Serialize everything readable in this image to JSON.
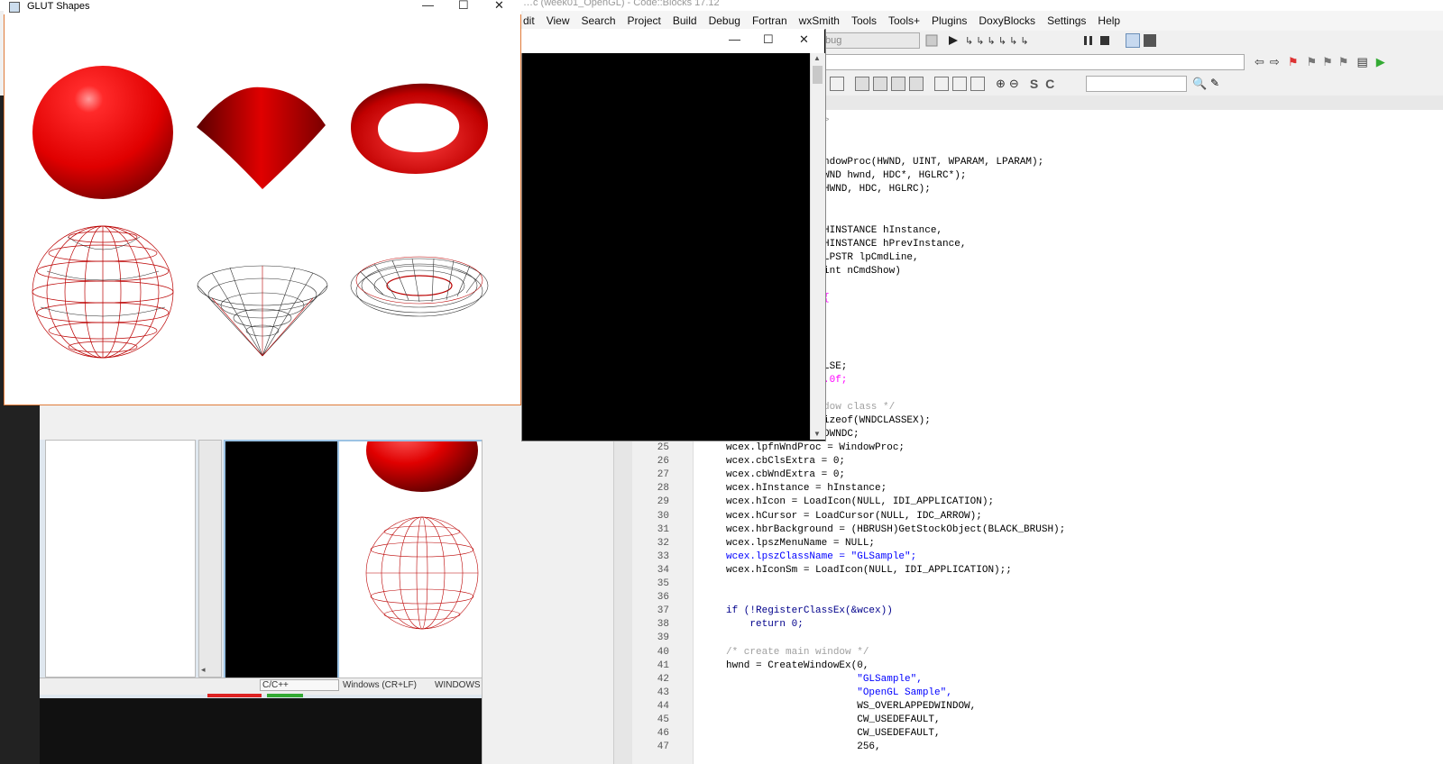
{
  "codeblocks": {
    "title_text": "…c (week01_OpenGL) - Code::Blocks 17.12",
    "menu": [
      "dit",
      "View",
      "Search",
      "Project",
      "Build",
      "Debug",
      "Fortran",
      "wxSmith",
      "Tools",
      "Tools+",
      "Plugins",
      "DoxyBlocks",
      "Settings",
      "Help"
    ],
    "build_target": "bug",
    "status": {
      "lang": "C/C++",
      "eol": "Windows (CR+LF)",
      "encoding": "WINDOWS"
    }
  },
  "glut_window": {
    "title": "GLUT Shapes",
    "minimize": "—",
    "maximize": "☐",
    "close": "✕"
  },
  "console_window": {
    "minimize": "—",
    "maximize": "☐",
    "close": "✕"
  },
  "editor": {
    "partial_top": [
      {
        "text": ">",
        "cls": "cmt"
      },
      {
        "text": "ndowProc(HWND, UINT, WPARAM, LPARAM);",
        "cls": "fn"
      },
      {
        "text": "WND hwnd, HDC*, HGLRC*);",
        "cls": "fn"
      },
      {
        "text": "HWND, HDC, HGLRC);",
        "cls": "fn"
      },
      {
        "text": "HINSTANCE hInstance,",
        "cls": "fn"
      },
      {
        "text": "HINSTANCE hPrevInstance,",
        "cls": "fn"
      },
      {
        "text": "LPSTR lpCmdLine,",
        "cls": "fn"
      },
      {
        "text": "int nCmdShow)",
        "cls": "fn"
      },
      {
        "text": "{",
        "cls": "num"
      },
      {
        "text": "LSE;",
        "cls": "fn"
      },
      {
        "text": ".0f;",
        "cls": "num"
      },
      {
        "text": "dow class */",
        "cls": "cmt"
      },
      {
        "text": "izeof(WNDCLASSEX);",
        "cls": "fn"
      },
      {
        "text": "OWNDC;",
        "cls": "fn"
      }
    ],
    "lines": [
      {
        "n": "25",
        "text": "wcex.lpfnWndProc = WindowProc;"
      },
      {
        "n": "26",
        "text": "wcex.cbClsExtra = 0;"
      },
      {
        "n": "27",
        "text": "wcex.cbWndExtra = 0;"
      },
      {
        "n": "28",
        "text": "wcex.hInstance = hInstance;"
      },
      {
        "n": "29",
        "text": "wcex.hIcon = LoadIcon(NULL, IDI_APPLICATION);"
      },
      {
        "n": "30",
        "text": "wcex.hCursor = LoadCursor(NULL, IDC_ARROW);"
      },
      {
        "n": "31",
        "text": "wcex.hbrBackground = (HBRUSH)GetStockObject(BLACK_BRUSH);"
      },
      {
        "n": "32",
        "text": "wcex.lpszMenuName = NULL;"
      },
      {
        "n": "33",
        "text": "wcex.lpszClassName = \"GLSample\";"
      },
      {
        "n": "34",
        "text": "wcex.hIconSm = LoadIcon(NULL, IDI_APPLICATION);;"
      },
      {
        "n": "35",
        "text": ""
      },
      {
        "n": "36",
        "text": ""
      },
      {
        "n": "37",
        "text": "if (!RegisterClassEx(&wcex))"
      },
      {
        "n": "38",
        "text": "    return 0;"
      },
      {
        "n": "39",
        "text": ""
      },
      {
        "n": "40",
        "text": "/* create main window */"
      },
      {
        "n": "41",
        "text": "hwnd = CreateWindowEx(0,"
      },
      {
        "n": "42",
        "text": "                      \"GLSample\","
      },
      {
        "n": "43",
        "text": "                      \"OpenGL Sample\","
      },
      {
        "n": "44",
        "text": "                      WS_OVERLAPPEDWINDOW,"
      },
      {
        "n": "45",
        "text": "                      CW_USEDEFAULT,"
      },
      {
        "n": "46",
        "text": "                      CW_USEDEFAULT,"
      },
      {
        "n": "47",
        "text": "                      256,"
      }
    ]
  },
  "colors": {
    "shape_red": "#e00000",
    "accent_orange": "#e07b39"
  }
}
